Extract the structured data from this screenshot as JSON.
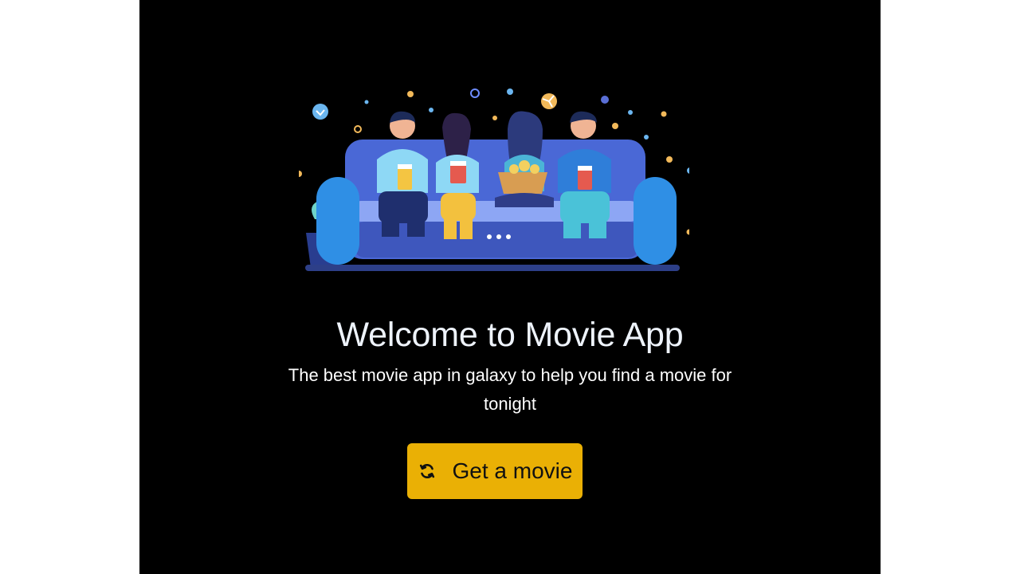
{
  "hero": {
    "title": "Welcome to Movie App",
    "subtitle": "The best movie app in galaxy to help you find a movie for tonight"
  },
  "cta": {
    "label": "Get a movie",
    "icon": "refresh-icon"
  },
  "colors": {
    "background": "#000000",
    "page_margin": "#ffffff",
    "button": "#eab005",
    "text": "#ffffff"
  }
}
